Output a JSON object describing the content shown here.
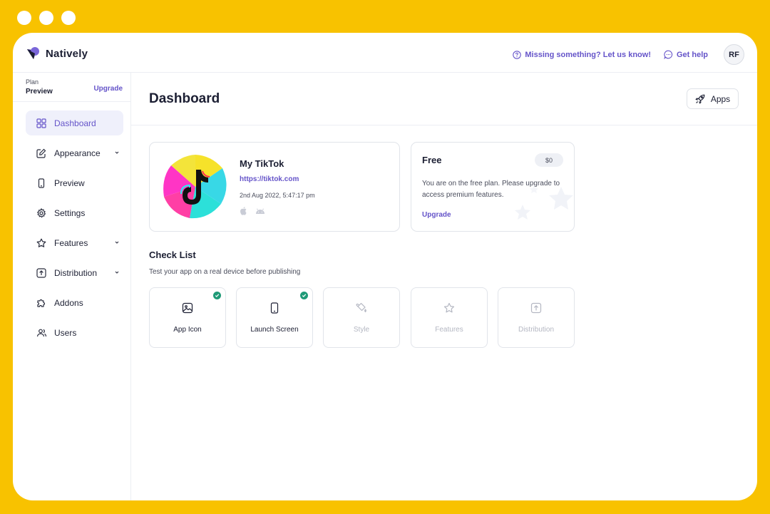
{
  "brand": {
    "name": "Natively"
  },
  "topbar": {
    "missing_link": "Missing something? Let us know!",
    "help_link": "Get help",
    "avatar_initials": "RF"
  },
  "sidebar": {
    "plan_label": "Plan",
    "plan_value": "Preview",
    "upgrade_label": "Upgrade",
    "items": [
      {
        "label": "Dashboard",
        "icon": "grid-icon",
        "active": true
      },
      {
        "label": "Appearance",
        "icon": "edit-icon",
        "expandable": true
      },
      {
        "label": "Preview",
        "icon": "phone-icon"
      },
      {
        "label": "Settings",
        "icon": "gear-icon"
      },
      {
        "label": "Features",
        "icon": "star-icon",
        "expandable": true
      },
      {
        "label": "Distribution",
        "icon": "upload-icon",
        "expandable": true
      },
      {
        "label": "Addons",
        "icon": "puzzle-icon"
      },
      {
        "label": "Users",
        "icon": "users-icon"
      }
    ]
  },
  "header": {
    "title": "Dashboard",
    "apps_button": "Apps"
  },
  "app_card": {
    "name": "My TikTok",
    "url": "https://tiktok.com",
    "date": "2nd Aug 2022, 5:47:17 pm",
    "platforms": [
      "apple-icon",
      "android-icon"
    ]
  },
  "plan_card": {
    "title": "Free",
    "price": "$0",
    "description": "You are on the free plan. Please upgrade to access premium features.",
    "upgrade_label": "Upgrade"
  },
  "checklist": {
    "title": "Check List",
    "subtitle": "Test your app on a real device before publishing",
    "items": [
      {
        "label": "App Icon",
        "icon": "image-icon",
        "done": true
      },
      {
        "label": "Launch Screen",
        "icon": "phone-icon",
        "done": true
      },
      {
        "label": "Style",
        "icon": "paint-bucket-icon",
        "done": false
      },
      {
        "label": "Features",
        "icon": "star-icon",
        "done": false
      },
      {
        "label": "Distribution",
        "icon": "upload-icon",
        "done": false
      }
    ]
  },
  "colors": {
    "frame": "#F8C200",
    "accent": "#6554C9",
    "active_bg": "#EFF0FB",
    "success": "#1F9A77"
  }
}
